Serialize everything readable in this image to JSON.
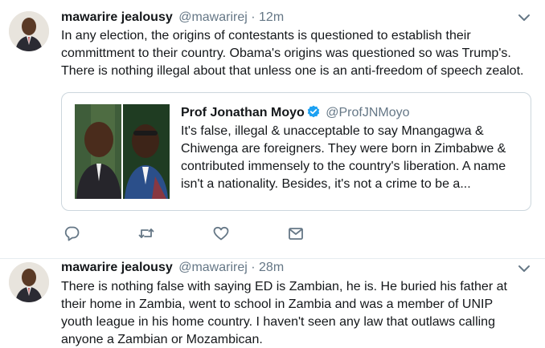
{
  "colors": {
    "text": "#14171a",
    "secondary": "#657786",
    "accent": "#1da1f2",
    "border": "#e6ecf0",
    "quote_border": "#ccd6dd"
  },
  "tweets": [
    {
      "author_name": "mawarire jealousy",
      "author_handle": "@mawarirej",
      "separator": "·",
      "time": "12m",
      "avatar_icon": "user-avatar",
      "menu_icon": "chevron-down-icon",
      "text_lines": [
        "In any election, the origins of contestants is questioned to establish their",
        "committment to their country. Obama's origins was questioned so was Trump's.",
        "There is nothing illegal about that unless one is an anti-freedom of speech zealot."
      ],
      "quote": {
        "author_name": "Prof Jonathan Moyo",
        "author_handle": "@ProfJNMoyo",
        "verified_icon": "verified-badge-icon",
        "text_lines": [
          "It's false, illegal & unacceptable to say Mnangagwa &",
          "Chiwenga are foreigners. They were born in Zimbabwe &",
          "contributed immensely to the country's liberation. A name",
          "isn't a nationality. Besides, it's not a crime to be a..."
        ]
      },
      "actions": [
        "reply-icon",
        "retweet-icon",
        "like-icon",
        "direct-message-icon"
      ]
    },
    {
      "author_name": "mawarire jealousy",
      "author_handle": "@mawarirej",
      "separator": "·",
      "time": "28m",
      "avatar_icon": "user-avatar",
      "menu_icon": "chevron-down-icon",
      "text_lines": [
        "There is nothing false with saying ED is Zambian, he is. He buried his father at",
        "their home in Zambia, went to school in Zambia and was a member of UNIP",
        "youth league in his home country. I haven't seen any law that outlaws calling",
        "anyone a Zambian or Mozambican."
      ]
    }
  ]
}
